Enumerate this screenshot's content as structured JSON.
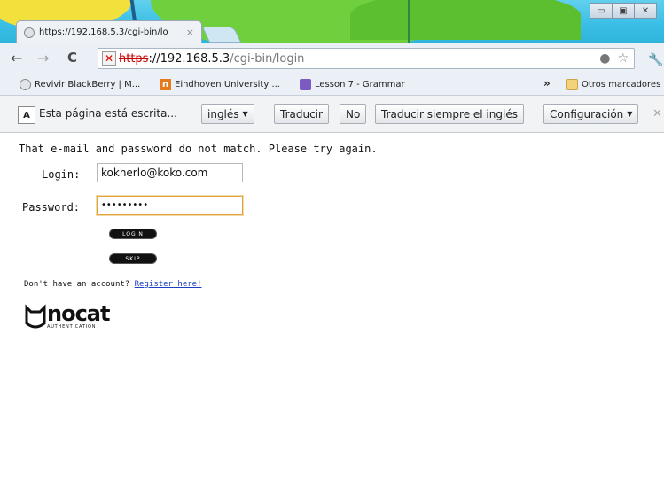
{
  "window": {
    "tab_title": "https://192.168.5.3/cgi-bin/lo",
    "tab_close": "×",
    "controls": {
      "minimize": "▭",
      "maximize": "▣",
      "close": "✕"
    }
  },
  "toolbar": {
    "back": "←",
    "forward": "→",
    "reload": "C",
    "url_scheme": "https",
    "url_host": "://192.168.5.3",
    "url_path": "/cgi-bin/login",
    "secure_icon": "✕",
    "star": "☆",
    "bulb": "●",
    "wrench": "🔧"
  },
  "bookmarks": {
    "items": [
      {
        "label": "Revivir BlackBerry | M...",
        "icon": "globe-icon"
      },
      {
        "label": "Eindhoven University ...",
        "icon": "n-icon"
      },
      {
        "label": "Lesson 7 - Grammar",
        "icon": "book-icon"
      }
    ],
    "overflow": "»",
    "other": "Otros marcadores"
  },
  "translate_bar": {
    "icon_text": "A",
    "message": "Esta página está escrita...",
    "language_select": "inglés",
    "translate_button": "Traducir",
    "no_button": "No",
    "always_button": "Traducir siempre el inglés",
    "options_button": "Configuración",
    "close": "✕"
  },
  "page": {
    "error": "That e-mail and password do not match. Please try again.",
    "login_label": "Login:",
    "login_value": "kokherlo@koko.com",
    "password_label": "Password:",
    "password_value": "•••••••••",
    "login_button": "LOGIN",
    "skip_button": "SKIP",
    "no_account_text": "Don't have an account?",
    "register_link": "Register here!",
    "logo_word": "nocat",
    "logo_sub": "AUTHENTICATION"
  },
  "colors": {
    "error_text": "#111111",
    "link": "#1b3fbf",
    "focus_border": "#e0a43a"
  }
}
